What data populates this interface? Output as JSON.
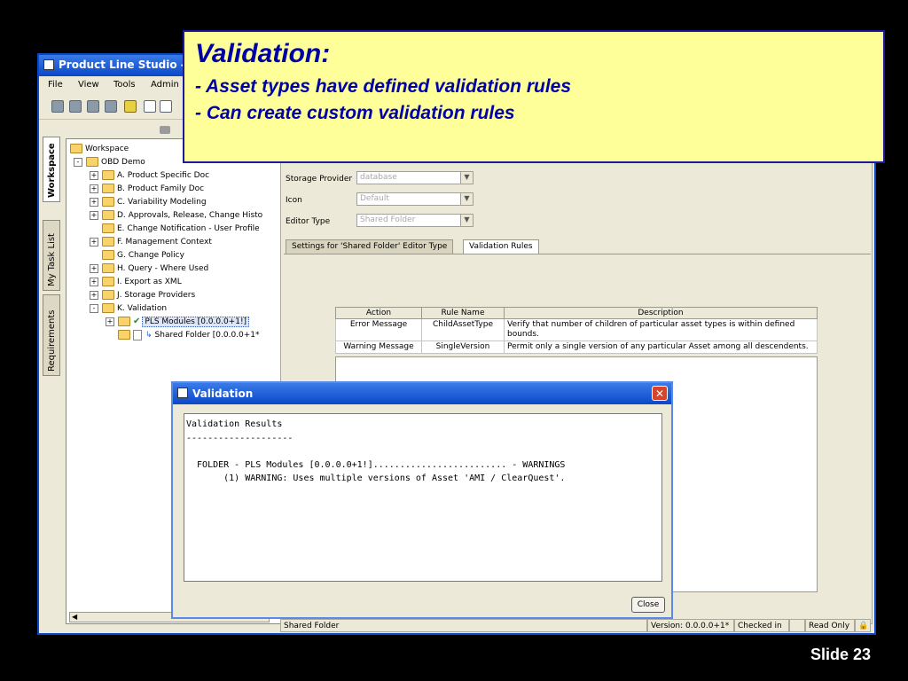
{
  "window": {
    "title": "Product Line Studio - M"
  },
  "menu": {
    "items": [
      "File",
      "View",
      "Tools",
      "Admin"
    ]
  },
  "side_tabs": [
    "Workspace",
    "My Task List",
    "Requirements"
  ],
  "tree": {
    "root": "Workspace",
    "project": "OBD Demo",
    "items": [
      "A. Product Specific Doc",
      "B. Product Family Doc",
      "C. Variability Modeling",
      "D. Approvals, Release, Change Histo",
      "E. Change Notification - User Profile",
      "F. Management Context",
      "G. Change Policy",
      "H. Query - Where Used",
      "I. Export as XML",
      "J. Storage Providers",
      "K. Validation"
    ],
    "selected": "PLS Modules [0.0.0.0+1!]",
    "child": "Shared Folder [0.0.0.0+1*"
  },
  "properties": {
    "storage_provider_label": "Storage Provider",
    "storage_provider_value": "database",
    "icon_label": "Icon",
    "icon_value": "Default",
    "editor_type_label": "Editor Type",
    "editor_type_value": "Shared Folder"
  },
  "tabs": [
    "Settings for 'Shared Folder' Editor Type",
    "Validation Rules"
  ],
  "rules_table": {
    "headers": [
      "Action",
      "Rule Name",
      "Description"
    ],
    "rows": [
      [
        "Error Message",
        "ChildAssetType",
        "Verify that number of children of particular asset types is within defined bounds."
      ],
      [
        "Warning Message",
        "SingleVersion",
        "Permit only a single version of any particular Asset among all descendents."
      ]
    ]
  },
  "status": {
    "path": "Shared Folder",
    "version": "Version: 0.0.0.0+1*",
    "checked": "Checked in",
    "readonly": "Read Only"
  },
  "callout": {
    "heading": "Validation:",
    "line1": "- Asset types have defined validation rules",
    "line2": "- Can create custom validation rules"
  },
  "dialog": {
    "title": "Validation",
    "line1": "Validation Results",
    "line2": "--------------------",
    "line3": "  FOLDER - PLS Modules [0.0.0.0+1!]......................... - WARNINGS",
    "line4": "       (1) WARNING: Uses multiple versions of Asset 'AMI / ClearQuest'.",
    "close_label": "Close"
  },
  "slide_number": "Slide 23"
}
